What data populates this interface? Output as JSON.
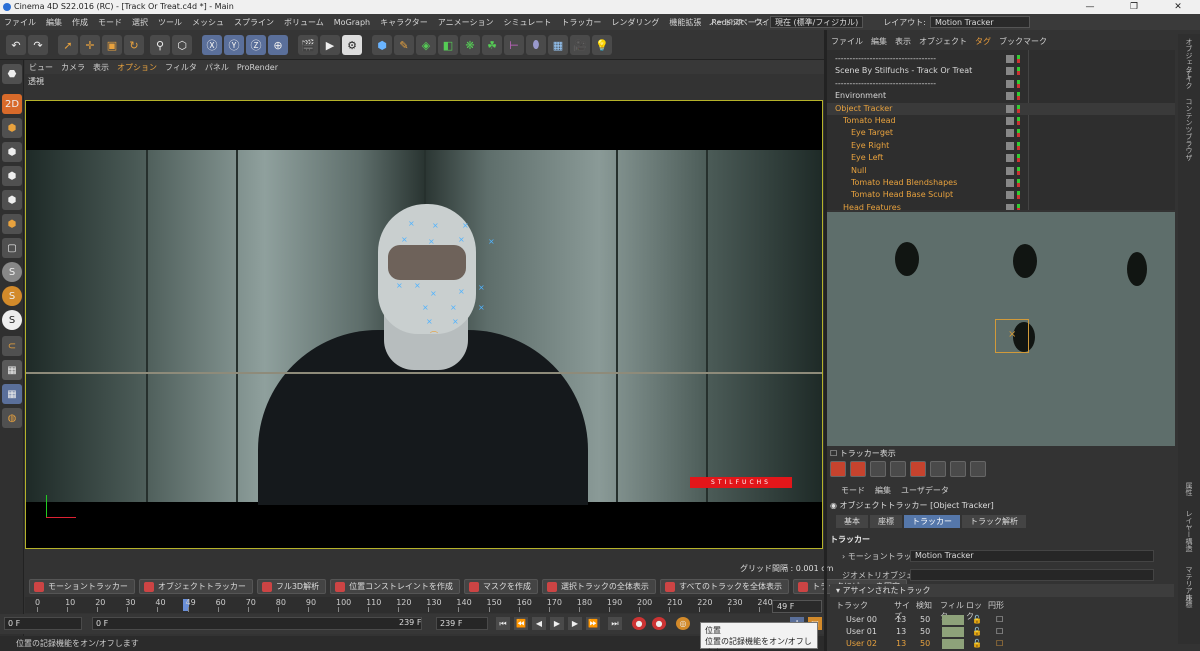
{
  "titlebar": {
    "title": "Cinema 4D S22.016 (RC) - [Track Or Treat.c4d *] - Main",
    "min": "—",
    "max": "❐",
    "close": "✕"
  },
  "menu": [
    "ファイル",
    "編集",
    "作成",
    "モード",
    "選択",
    "ツール",
    "メッシュ",
    "スプライン",
    "ボリューム",
    "MoGraph",
    "キャラクター",
    "アニメーション",
    "シミュレート",
    "トラッカー",
    "レンダリング",
    "機能拡張",
    "Redshift",
    "ウインドウ",
    "ヘルプ"
  ],
  "nodespace": {
    "label": "ノードスペース:",
    "value": "現在 (標準/フィジカル)"
  },
  "layout": {
    "label": "レイアウト:",
    "value": "Motion Tracker"
  },
  "viewport_menu": [
    "ビュー",
    "カメラ",
    "表示",
    "オプション",
    "フィルタ",
    "パネル",
    "ProRender"
  ],
  "viewport_label": "透視",
  "watermark": "STILFUCHS",
  "grid_text": "グリッド間隔 : 0.001 cm",
  "tracker_buttons": [
    "モーショントラッカー",
    "オブジェクトトラッカー",
    "フル3D解析",
    "位置コンストレイントを作成",
    "マスクを作成",
    "選択トラックの全体表示",
    "すべてのトラックを全体表示",
    "トラックにビューを固定"
  ],
  "timeline": {
    "ticks": [
      "0",
      "10",
      "20",
      "30",
      "40",
      "49",
      "60",
      "70",
      "80",
      "90",
      "100",
      "110",
      "120",
      "130",
      "140",
      "150",
      "160",
      "170",
      "180",
      "190",
      "200",
      "210",
      "220",
      "230",
      "240"
    ],
    "end_field": "49 F"
  },
  "transport": {
    "start": "0 F",
    "cur": "0 F",
    "end_a": "239 F",
    "end_b": "239 F"
  },
  "status": "位置の記録機能をオン/オフします",
  "tooltip": {
    "title": "位置",
    "body": "位置の記録機能をオン/オフします"
  },
  "object_menu": [
    "ファイル",
    "編集",
    "表示",
    "オブジェクト",
    "タグ",
    "ブックマーク"
  ],
  "objects": [
    {
      "name": "-----------------------------------",
      "indent": 0,
      "color": "#d8d8d8"
    },
    {
      "name": "Scene By Stilfuchs - Track Or Treat",
      "indent": 0,
      "color": "#d8d8d8"
    },
    {
      "name": "-----------------------------------",
      "indent": 0,
      "color": "#d8d8d8"
    },
    {
      "name": "Environment",
      "indent": 0,
      "color": "#d8d8d8"
    },
    {
      "name": "Object Tracker",
      "indent": 0,
      "color": "#e8a23e"
    },
    {
      "name": "Tomato Head",
      "indent": 1,
      "color": "#e8a23e"
    },
    {
      "name": "Eye Target",
      "indent": 2,
      "color": "#e8a23e"
    },
    {
      "name": "Eye Right",
      "indent": 2,
      "color": "#e8a23e"
    },
    {
      "name": "Eye Left",
      "indent": 2,
      "color": "#e8a23e"
    },
    {
      "name": "Null",
      "indent": 2,
      "color": "#e8a23e"
    },
    {
      "name": "Tomato Head Blendshapes",
      "indent": 2,
      "color": "#e8a23e"
    },
    {
      "name": "Tomato Head Base Sculpt",
      "indent": 2,
      "color": "#e8a23e"
    },
    {
      "name": "Head Features",
      "indent": 1,
      "color": "#e8a23e"
    }
  ],
  "right_tabs": [
    "オブジェクト",
    "テイク",
    "コンテンツブラウザ",
    "属性",
    "レイヤー",
    "構造",
    "マテリアル",
    "座標"
  ],
  "tracker_view_label": "トラッカー表示",
  "attr_menu": [
    "モード",
    "編集",
    "ユーザデータ"
  ],
  "attr_title": "オブジェクトトラッカー [Object Tracker]",
  "attr_tabs": [
    "基本",
    "座標",
    "トラッカー",
    "トラック解析"
  ],
  "section_title": "トラッカー",
  "props": {
    "motion_label": "モーショントラッカー",
    "motion_value": "Motion Tracker",
    "geo_label": "ジオメトリオブジェクト"
  },
  "assigned": "▾ アサインされたトラック",
  "track_header": [
    "トラック",
    "サイズ",
    "検知",
    "フィルタ",
    "ロック",
    "円形"
  ],
  "tracks": [
    {
      "name": "User 00",
      "size": "13",
      "det": "50",
      "color": "#d8d8d8"
    },
    {
      "name": "User 01",
      "size": "13",
      "det": "50",
      "color": "#d8d8d8"
    },
    {
      "name": "User 02",
      "size": "13",
      "det": "50",
      "color": "#e8a23e"
    }
  ]
}
